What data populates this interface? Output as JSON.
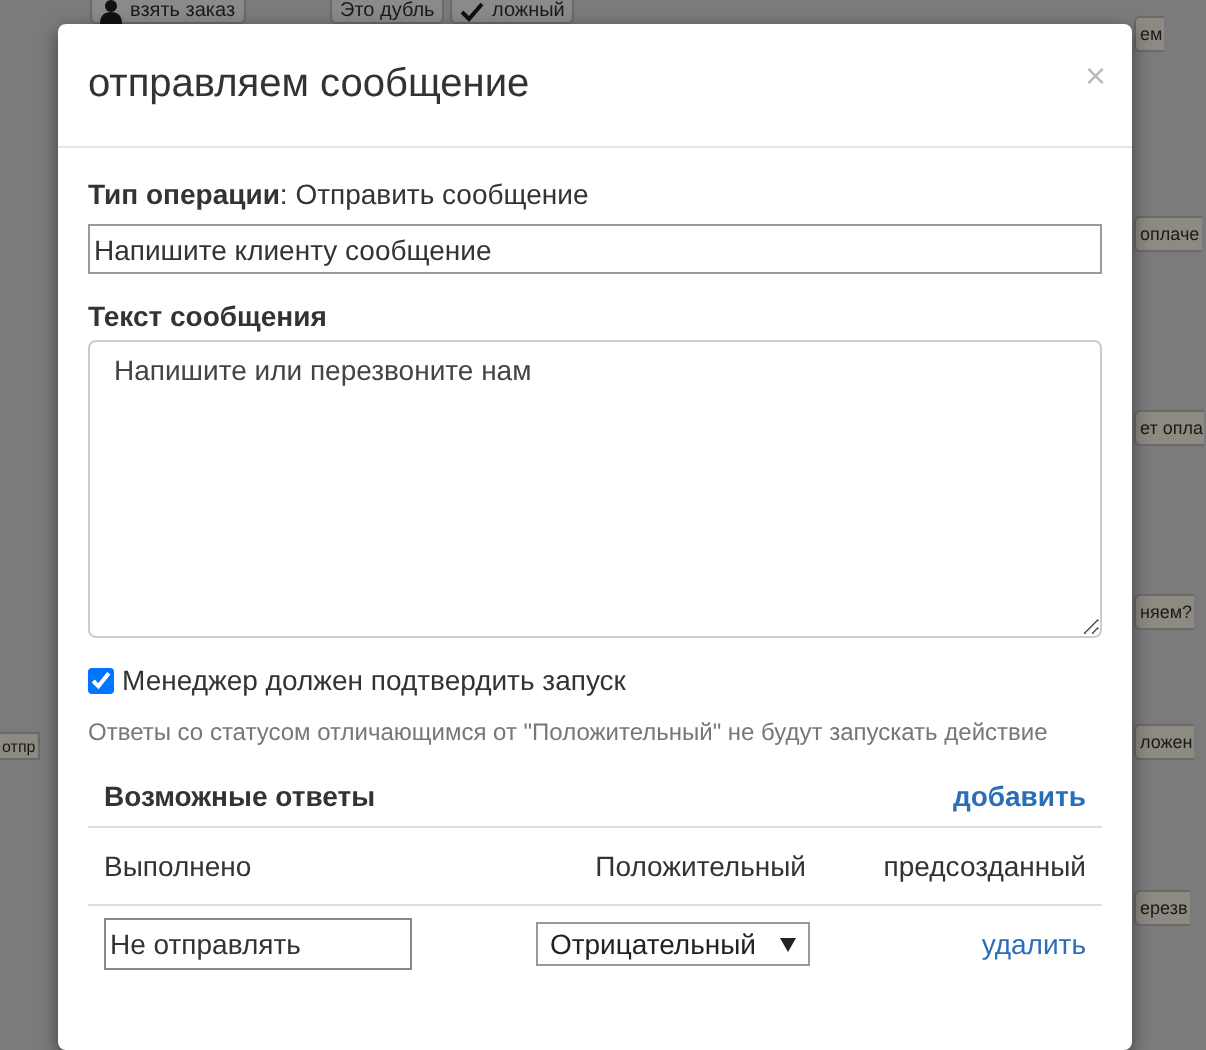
{
  "background": {
    "nodes": [
      {
        "label": "взять заказ",
        "kind": "person"
      },
      {
        "label": "Это дубль",
        "kind": "plain"
      },
      {
        "label": "ложный",
        "kind": "check"
      },
      {
        "label": "ем",
        "kind": "plain"
      },
      {
        "label": "оплаче",
        "kind": "plain"
      },
      {
        "label": "ет опла",
        "kind": "plain"
      },
      {
        "label": "няем?",
        "kind": "plain"
      },
      {
        "label": "отпр",
        "kind": "plain"
      },
      {
        "label": "ложен",
        "kind": "plain"
      },
      {
        "label": "ерезв",
        "kind": "plain"
      }
    ]
  },
  "dialog": {
    "title": "отправляем сообщение",
    "close": "×",
    "operation": "**Тип операции**: Отправить сообщение",
    "name_field": {
      "value": "Напишите клиенту сообщение"
    },
    "message_label": "Текст сообщения",
    "message_field": {
      "value": "Напишите или перезвоните нам"
    },
    "confirm": {
      "label": "Менеджер должен подтвердить запуск",
      "checked": true
    },
    "hint": "Ответы со статусом отличающимся от \"Положительный\" не будут запускать действие",
    "answers": {
      "title": "Возможные ответы",
      "add_link": "добавить",
      "rows": [
        {
          "kind": "static",
          "name": "Выполнено",
          "status": "Положительный",
          "action": "предсозданный"
        },
        {
          "kind": "editable",
          "name": "Не отправлять",
          "status": "Отрицательный",
          "action": "удалить"
        }
      ]
    }
  }
}
